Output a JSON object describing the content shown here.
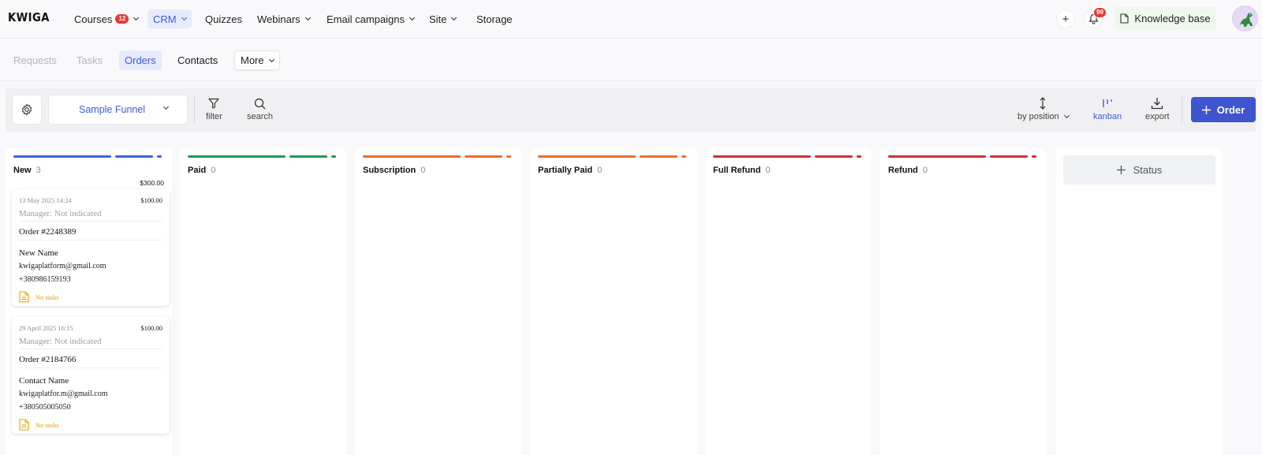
{
  "header": {
    "logo": "KWIGA",
    "nav": [
      {
        "label": "Courses",
        "badge": "12",
        "dropdown": true
      },
      {
        "label": "CRM",
        "dropdown": true,
        "active": true
      },
      {
        "label": "Quizzes",
        "dropdown": false
      },
      {
        "label": "Webinars",
        "dropdown": true
      },
      {
        "label": "Email campaigns",
        "dropdown": true
      },
      {
        "label": "Site",
        "dropdown": true
      },
      {
        "label": "Storage",
        "dropdown": false
      }
    ],
    "add_label": "+",
    "notifications_count": "99",
    "knowledge_base_label": "Knowledge base"
  },
  "subnav": {
    "items": [
      "Requests",
      "Tasks",
      "Orders",
      "Contacts"
    ],
    "active": "Orders",
    "more_label": "More"
  },
  "toolbar": {
    "funnel": "Sample Funnel",
    "filter_label": "filter",
    "search_label": "search",
    "sort_label": "by position",
    "kanban_label": "kanban",
    "export_label": "export",
    "order_button_label": "Order"
  },
  "columns": [
    {
      "title": "New",
      "count": "3",
      "total": "$300.00",
      "color": "#3b63e0"
    },
    {
      "title": "Paid",
      "count": "0",
      "color": "#1e9a52"
    },
    {
      "title": "Subscription",
      "count": "0",
      "color": "#ee6b2f"
    },
    {
      "title": "Partially Paid",
      "count": "0",
      "color": "#ee6b2f"
    },
    {
      "title": "Full Refund",
      "count": "0",
      "color": "#d32f2f"
    },
    {
      "title": "Refund",
      "count": "0",
      "color": "#d32f2f"
    }
  ],
  "cards": [
    {
      "date": "13 May 2025 14:24",
      "amount": "$100.00",
      "manager": "Manager: Not indicated",
      "order": "Order #2248389",
      "contact": "New Name",
      "email": "kwigaplatform@gmail.com",
      "phone": "+380986159193",
      "tasks": "No tasks"
    },
    {
      "date": "29 April 2025 16:15",
      "amount": "$100.00",
      "manager": "Manager: Not indicated",
      "order": "Order #2184766",
      "contact": "Contact Name",
      "email": "kwigaplatfor.m@gmail.com",
      "phone": "+380505005050",
      "tasks": "No tasks"
    }
  ],
  "add_status_label": "Status"
}
